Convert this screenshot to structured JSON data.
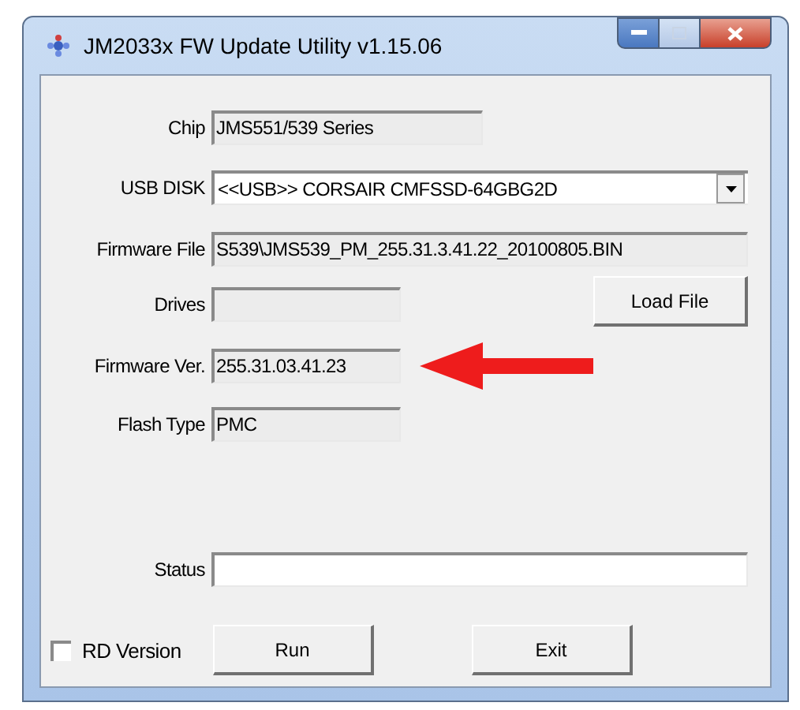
{
  "window": {
    "title": "JM2033x FW Update Utility v1.15.06"
  },
  "chip": {
    "label": "Chip",
    "value": "JMS551/539 Series"
  },
  "usb_disk": {
    "label": "USB DISK",
    "value": "<<USB>> CORSAIR CMFSSD-64GBG2D"
  },
  "firmware_file": {
    "label": "Firmware File",
    "value": "S539\\JMS539_PM_255.31.3.41.22_20100805.BIN"
  },
  "drives": {
    "label": "Drives"
  },
  "load_file_button": "Load File",
  "firmware_ver": {
    "label": "Firmware Ver.",
    "value": "255.31.03.41.23"
  },
  "flash_type": {
    "label": "Flash Type",
    "value": "PMC"
  },
  "status": {
    "label": "Status"
  },
  "rd_version": {
    "label": "RD Version",
    "checked": false
  },
  "buttons": [
    "Run",
    "Exit"
  ]
}
